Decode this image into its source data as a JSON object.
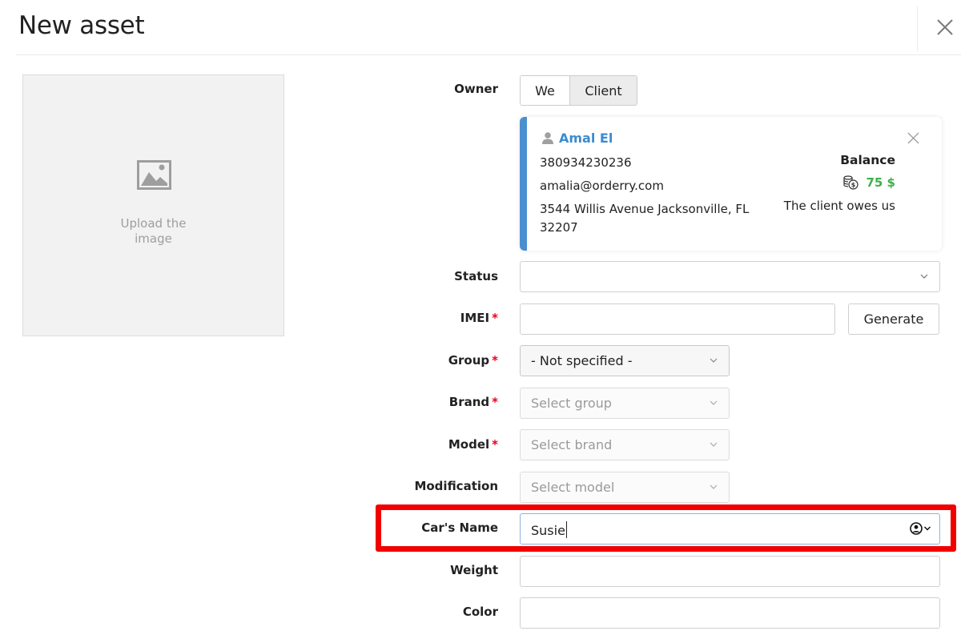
{
  "dialog": {
    "title": "New asset",
    "close_label": "close"
  },
  "upload": {
    "text_line1": "Upload the",
    "text_line2": "image"
  },
  "owner": {
    "label": "Owner",
    "options": [
      "We",
      "Client"
    ],
    "selected": "Client"
  },
  "client_card": {
    "name": "Amal El",
    "phone": "380934230236",
    "email": "amalia@orderry.com",
    "address_line1": "3544 Willis Avenue Jacksonville, FL",
    "address_line2": "32207",
    "balance_label": "Balance",
    "balance_amount": "75 $",
    "balance_note": "The client owes us",
    "accent_color": "#4a90d0",
    "balance_color": "#3db04b"
  },
  "form": {
    "status": {
      "label": "Status",
      "value": ""
    },
    "imei": {
      "label": "IMEI",
      "required_mark": "*",
      "value": "",
      "generate_label": "Generate"
    },
    "group": {
      "label": "Group",
      "required_mark": "*",
      "value": "- Not specified -"
    },
    "brand": {
      "label": "Brand",
      "required_mark": "*",
      "placeholder": "Select group"
    },
    "model": {
      "label": "Model",
      "required_mark": "*",
      "placeholder": "Select brand"
    },
    "modification": {
      "label": "Modification",
      "placeholder": "Select model"
    },
    "cars_name": {
      "label": "Car's Name",
      "value": "Susie"
    },
    "weight": {
      "label": "Weight",
      "value": ""
    },
    "color": {
      "label": "Color",
      "value": ""
    }
  },
  "highlight_color": "#f20000"
}
